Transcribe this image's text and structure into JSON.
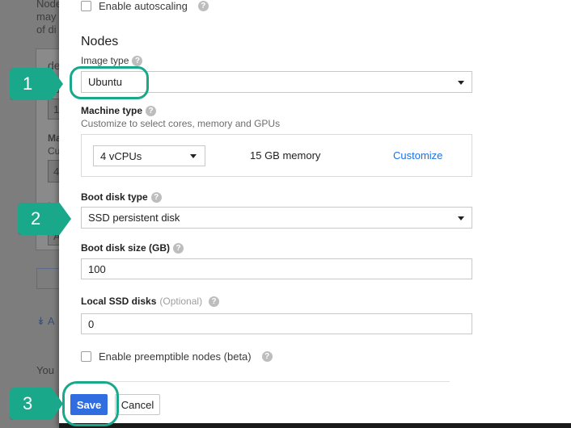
{
  "background": {
    "texts": [
      "Node",
      "may",
      "of di",
      "de",
      "Nu",
      "1",
      "Ma",
      "Cu",
      "4",
      "Im",
      "A",
      "A",
      "You"
    ]
  },
  "dialog": {
    "autoscaling_label": "Enable autoscaling",
    "section_title": "Nodes",
    "image_type": {
      "label": "Image type",
      "value": "Ubuntu"
    },
    "machine_type": {
      "label": "Machine type",
      "sublabel": "Customize to select cores, memory and GPUs",
      "cpu_value": "4 vCPUs",
      "memory_text": "15 GB memory",
      "customize_link": "Customize"
    },
    "boot_disk_type": {
      "label": "Boot disk type",
      "value": "SSD persistent disk"
    },
    "boot_disk_size": {
      "label": "Boot disk size (GB)",
      "value": "100"
    },
    "local_ssd": {
      "label": "Local SSD disks",
      "optional": "(Optional)",
      "value": "0"
    },
    "preemptible_label": "Enable preemptible nodes (beta)",
    "save_label": "Save",
    "cancel_label": "Cancel"
  },
  "callouts": [
    "1",
    "2",
    "3"
  ],
  "colors": {
    "accent": "#1aa88a",
    "primary_button": "#2f6de0",
    "link": "#1a73e8"
  }
}
